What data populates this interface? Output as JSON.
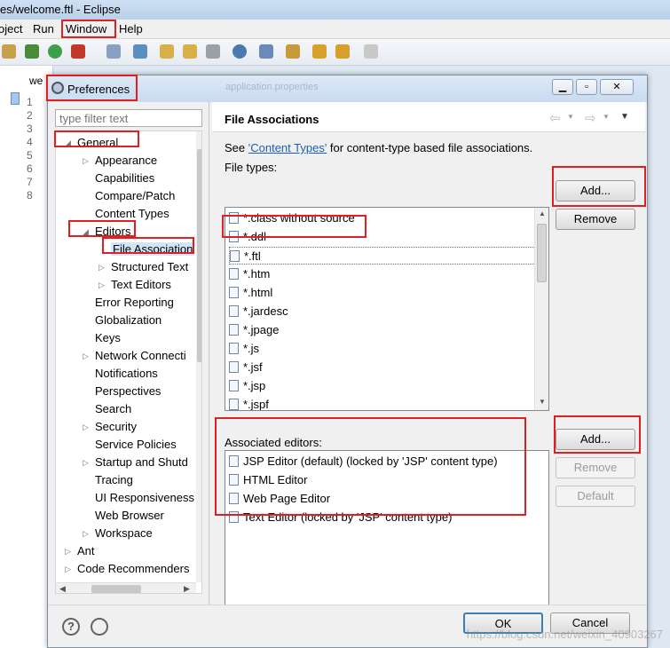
{
  "window": {
    "title": "es/welcome.ftl - Eclipse"
  },
  "menu": [
    "oject",
    "Run",
    "Window",
    "Help"
  ],
  "editor": {
    "tab_label": "we",
    "line_numbers": [
      "1",
      "2",
      "3",
      "4",
      "5",
      "6",
      "7",
      "8"
    ],
    "background_tab": "application.properties"
  },
  "dialog": {
    "title": "Preferences",
    "filter_placeholder": "type filter text",
    "tree": {
      "general": "General",
      "appearance": "Appearance",
      "capabilities": "Capabilities",
      "compare_patch": "Compare/Patch",
      "content_types": "Content Types",
      "editors": "Editors",
      "file_associations": "File Association",
      "structured_text": "Structured Text",
      "text_editors": "Text Editors",
      "error_reporting": "Error Reporting",
      "globalization": "Globalization",
      "keys": "Keys",
      "network": "Network Connecti",
      "notifications": "Notifications",
      "perspectives": "Perspectives",
      "search": "Search",
      "security": "Security",
      "service_policies": "Service Policies",
      "startup": "Startup and Shutd",
      "tracing": "Tracing",
      "ui_responsiveness": "UI Responsiveness",
      "web_browser": "Web Browser",
      "workspace": "Workspace",
      "ant": "Ant",
      "code_recommenders": "Code Recommenders"
    },
    "page_title": "File Associations",
    "see_prefix": "See ",
    "see_link": "'Content Types'",
    "see_suffix": " for content-type based file associations.",
    "file_types_label": "File types:",
    "file_types": [
      "*.class without source",
      "*.ddl",
      "*.ftl",
      "*.htm",
      "*.html",
      "*.jardesc",
      "*.jpage",
      "*.js",
      "*.jsf",
      "*.jsp",
      "*.jspf"
    ],
    "assoc_label": "Associated editors:",
    "editors": [
      "JSP Editor (default) (locked by 'JSP' content type)",
      "HTML Editor",
      "Web Page Editor",
      "Text Editor (locked by 'JSP' content type)"
    ],
    "buttons": {
      "add_types": "Add...",
      "remove_types": "Remove",
      "add_editors": "Add...",
      "remove_editors": "Remove",
      "default": "Default",
      "ok": "OK",
      "cancel": "Cancel"
    },
    "help_glyph": "?"
  },
  "watermark": "https://blog.csdn.net/weixin_40903267"
}
